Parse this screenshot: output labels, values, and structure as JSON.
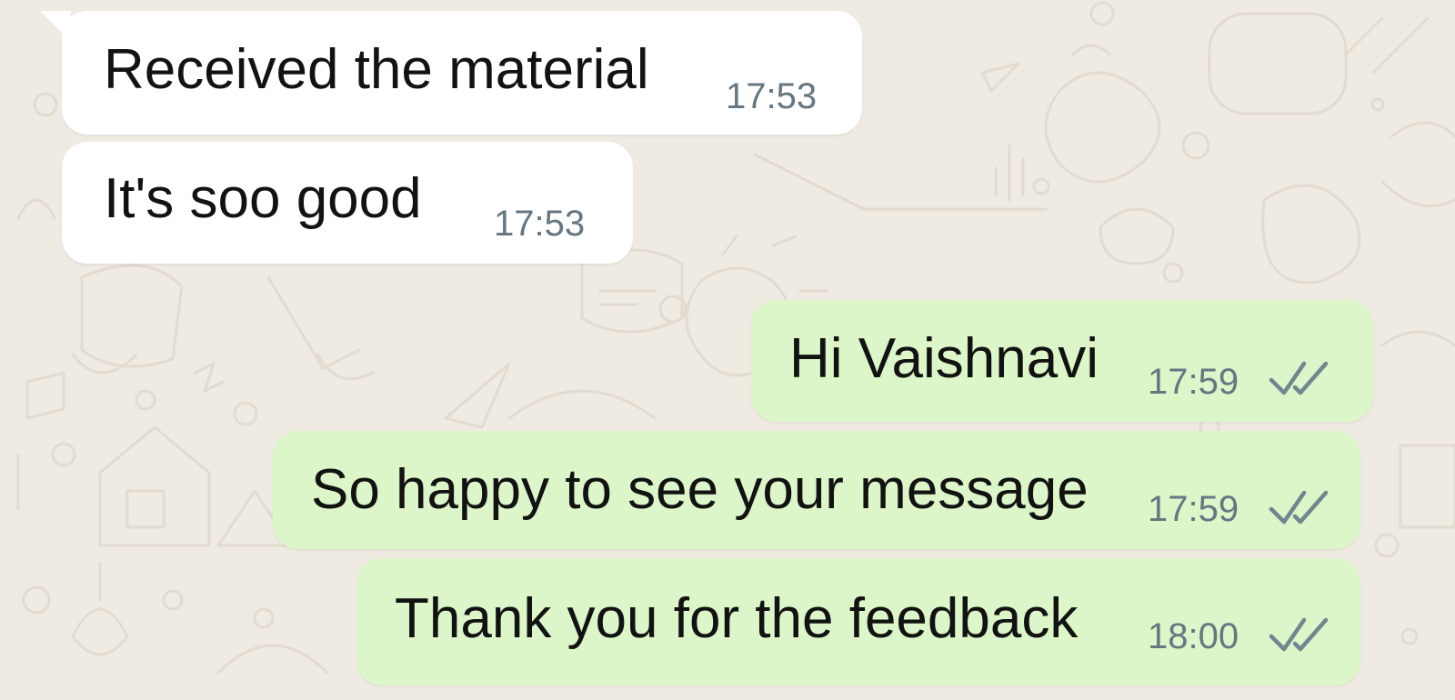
{
  "conversation": {
    "incoming": [
      {
        "text": "Received the material",
        "time": "17:53"
      },
      {
        "text": "It's soo good",
        "time": "17:53"
      }
    ],
    "outgoing": [
      {
        "text": "Hi Vaishnavi",
        "time": "17:59",
        "status_icon": "double-check-icon"
      },
      {
        "text": "So happy to see your message",
        "time": "17:59",
        "status_icon": "double-check-icon"
      },
      {
        "text": "Thank you for the feedback",
        "time": "18:00",
        "status_icon": "double-check-icon"
      }
    ]
  },
  "colors": {
    "wallpaper": "#efeae2",
    "incoming_bubble": "#ffffff",
    "outgoing_bubble": "#dcf6c9",
    "timestamp": "#667781",
    "read_receipt": "#6f8791"
  }
}
